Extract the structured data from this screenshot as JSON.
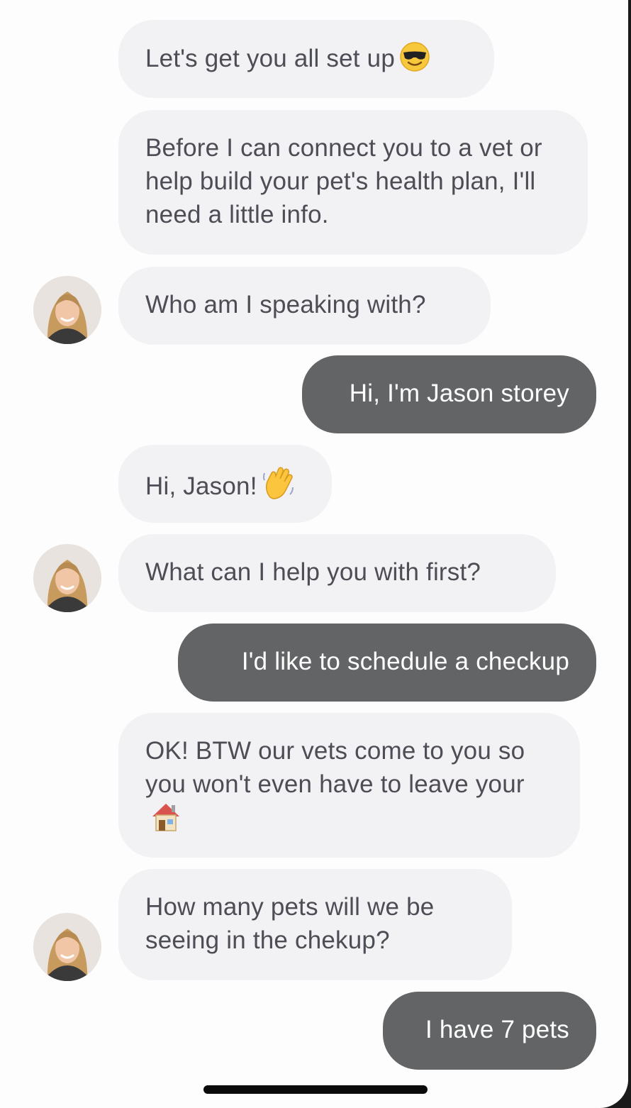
{
  "conversation": {
    "messages": [
      {
        "sender": "bot",
        "text": "Let's get you all set up",
        "emoji": "smiling-face-with-sunglasses-emoji"
      },
      {
        "sender": "bot",
        "text": "Before I can connect you to a vet or help build your pet's health plan, I'll need a little info."
      },
      {
        "sender": "bot",
        "text": "Who am I speaking with?"
      },
      {
        "sender": "user",
        "text": "Hi, I'm Jason storey"
      },
      {
        "sender": "bot",
        "text": "Hi, Jason!",
        "emoji": "waving-hand-emoji"
      },
      {
        "sender": "bot",
        "text": "What can I help you with first?"
      },
      {
        "sender": "user",
        "text": "I'd like to schedule a checkup"
      },
      {
        "sender": "bot",
        "text": "OK! BTW our vets come to you so you won't even have to leave your",
        "emoji": "house-emoji"
      },
      {
        "sender": "bot",
        "text": "How many pets will we be seeing in the chekup?"
      },
      {
        "sender": "user",
        "text": "I have 7 pets"
      }
    ]
  },
  "colors": {
    "bot_bubble": "#f2f1f4",
    "bot_text": "#4d4d55",
    "user_bubble": "#636466",
    "user_text": "#ffffff",
    "background": "#fdfdfd"
  },
  "icons": {
    "avatar": "agent-avatar-photo",
    "home_indicator": "home-indicator-bar"
  }
}
